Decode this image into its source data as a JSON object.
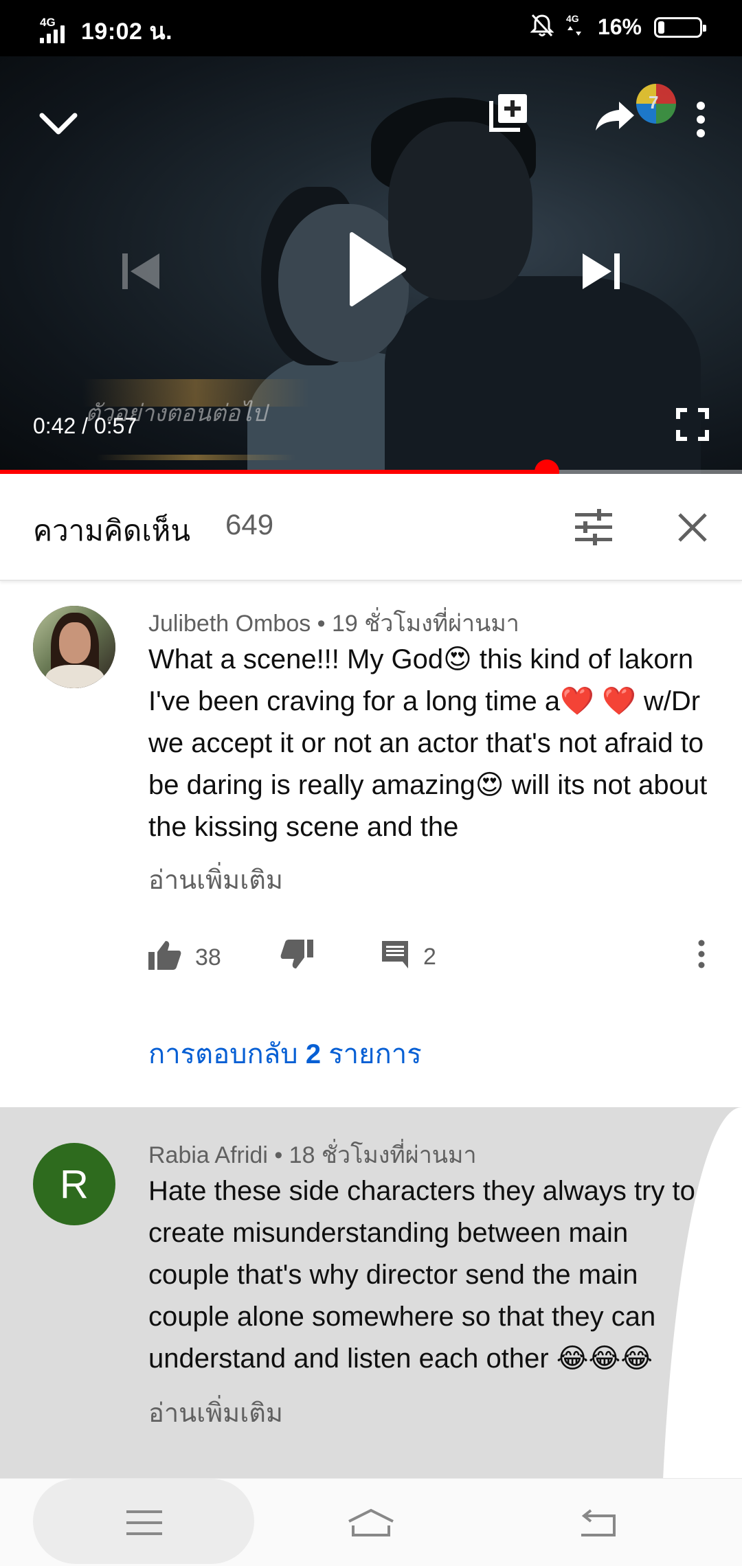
{
  "status_bar": {
    "network": "4G",
    "time": "19:02 น.",
    "battery_percent": "16%",
    "battery_level": 0.16,
    "icons": [
      "signal-icon",
      "mute-bell-icon",
      "data-4g-icon",
      "battery-icon"
    ]
  },
  "player": {
    "current_time": "0:42",
    "duration": "0:57",
    "time_display": "0:42 / 0:57",
    "progress_fraction": 0.737,
    "watermark": "ตัวอย่างตอนต่อไป",
    "channel_badge_text": "7",
    "accent_color": "#ff0000",
    "icons": [
      "minimize-chevron-icon",
      "add-to-playlist-icon",
      "share-icon",
      "more-options-icon",
      "previous-icon",
      "play-icon",
      "next-icon",
      "fullscreen-icon"
    ]
  },
  "comments_header": {
    "title": "ความคิดเห็น",
    "count": "649",
    "icons": [
      "filter-sort-icon",
      "close-icon"
    ]
  },
  "comments": [
    {
      "author": "Julibeth Ombos",
      "time_ago": "19 ชั่วโมงที่ผ่านมา",
      "meta": "Julibeth Ombos • 19 ชั่วโมงที่ผ่านมา",
      "text": "What a scene!!! My God😍 this kind of lakorn I've been craving for a long time a❤️ ❤️ w/Dr we accept it or not an actor that's not afraid to be daring is really amazing😍 will its not about the kissing scene and the",
      "read_more": "อ่านเพิ่มเติม",
      "likes": "38",
      "replies_count": "2",
      "replies_link_prefix": "การตอบกลับ",
      "replies_link_count": "2",
      "replies_link_suffix": "รายการ"
    },
    {
      "author": "Rabia Afridi",
      "avatar_letter": "R",
      "avatar_color": "#2e6b1e",
      "time_ago": "18 ชั่วโมงที่ผ่านมา",
      "meta": "Rabia Afridi • 18 ชั่วโมงที่ผ่านมา",
      "text": "Hate these side characters they always try to create misunderstanding between main couple that's why director send the main couple alone somewhere so that they can understand and listen each other 😂😂😂",
      "read_more": "อ่านเพิ่มเติม"
    }
  ],
  "nav_bar": {
    "icons": [
      "recent-apps-icon",
      "home-icon",
      "back-icon"
    ]
  },
  "colors": {
    "link_blue": "#065fd4",
    "secondary_text": "#606060",
    "highlight_bg": "#dcdcdc"
  }
}
